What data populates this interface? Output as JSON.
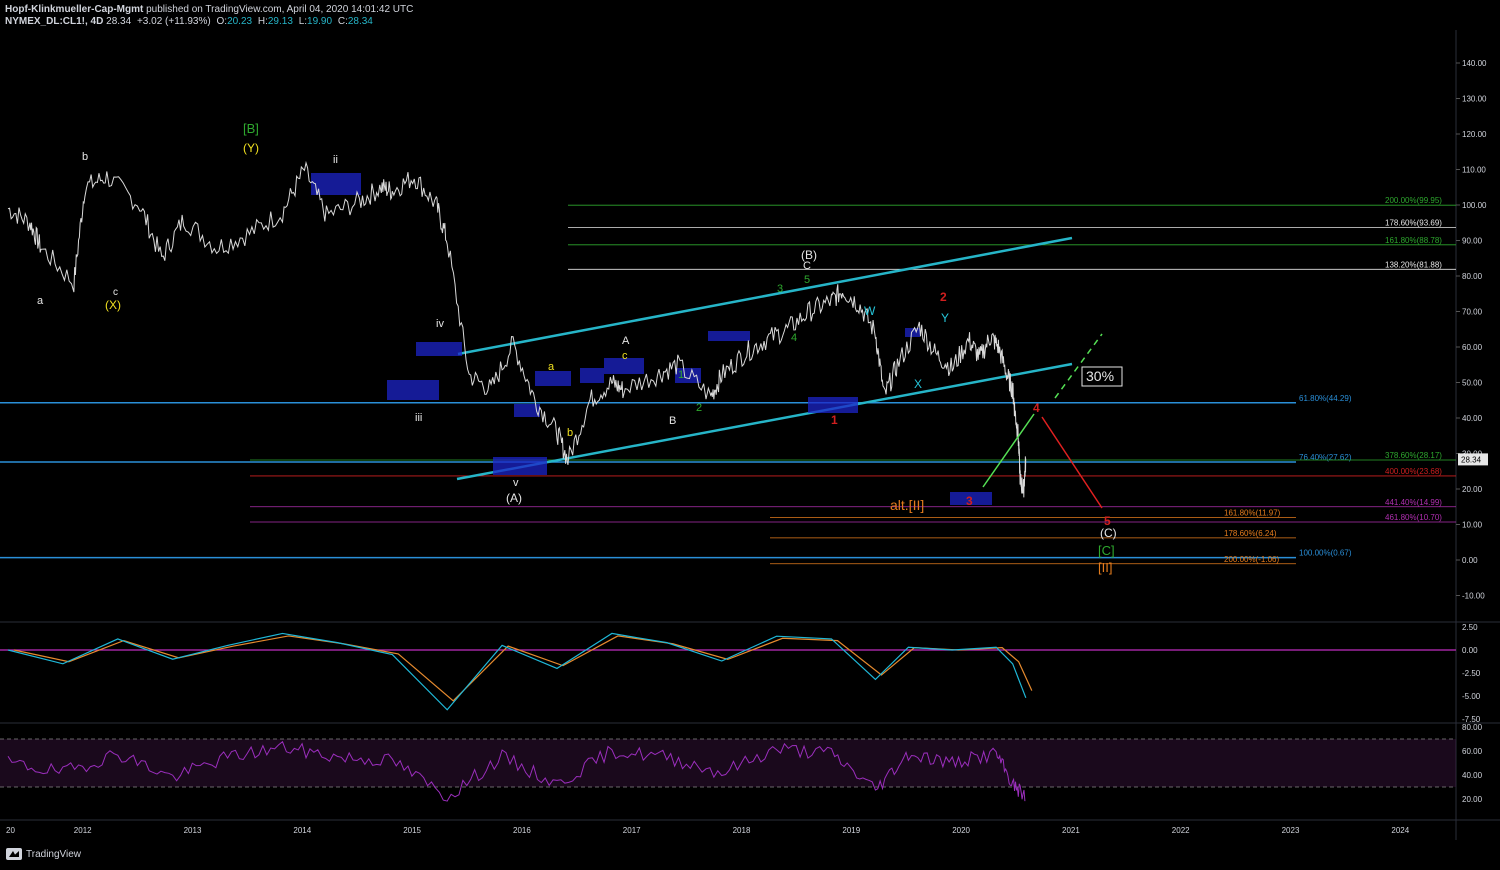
{
  "header": {
    "publisher": "Hopf-Klinkmueller-Cap-Mgmt",
    "published": "published on TradingView.com, April 04, 2020 14:01:42 UTC",
    "symbol": "NYMEX_DL:CL1!, 4D",
    "last": "28.34",
    "change": "+3.02 (+11.93%)",
    "open_label": "O:",
    "open": "20.23",
    "high_label": "H:",
    "high": "29.13",
    "low_label": "L:",
    "low": "19.90",
    "close_label": "C:",
    "close": "28.34"
  },
  "footer": {
    "brand": "TradingView"
  },
  "colors": {
    "bg": "#000000",
    "price": "#d9d9d9",
    "channel": "#26b5c8",
    "fib_blue": "#2a8fd8",
    "green": "#2ea82e",
    "white": "#e6e6e6",
    "orange": "#e37b1d",
    "magenta": "#b12fb1",
    "red": "#d11f1f",
    "box": "#1c24c8",
    "macd": "#1fb8d8",
    "signal": "#e68a2e",
    "rsi": "#9b2ebd"
  },
  "chart_data": [
    {
      "type": "line",
      "title": "",
      "x_ticks": [
        "20",
        "2012",
        "2013",
        "2014",
        "2015",
        "2016",
        "2017",
        "2018",
        "2019",
        "2020",
        "2021",
        "2022",
        "2023",
        "2024"
      ],
      "y_ticks": [
        "140.00",
        "130.00",
        "120.00",
        "110.00",
        "100.00",
        "90.00",
        "80.00",
        "70.00",
        "60.00",
        "50.00",
        "40.00",
        "30.00",
        "20.00",
        "10.00",
        "0.00",
        "-10.00"
      ],
      "ylim": [
        -14,
        147
      ],
      "current_price_label": "28.34",
      "series": [
        {
          "x": [
            2011.0,
            2011.2,
            2011.3,
            2011.6,
            2011.7,
            2011.9,
            2012.2,
            2012.4,
            2012.6,
            2012.9,
            2013.2,
            2013.5,
            2013.7,
            2013.9,
            2014.2,
            2014.4,
            2014.5,
            2014.7,
            2014.9,
            2015.0,
            2015.2,
            2015.4,
            2015.6,
            2015.8,
            2016.0,
            2016.1,
            2016.3,
            2016.5,
            2016.6,
            2016.9,
            2017.1,
            2017.4,
            2017.5,
            2017.7,
            2017.9,
            2018.1,
            2018.3,
            2018.5,
            2018.6,
            2018.75,
            2018.9,
            2018.98,
            2019.1,
            2019.3,
            2019.45,
            2019.6,
            2019.75,
            2019.85,
            2019.95,
            2020.02,
            2020.1,
            2020.15,
            2020.17,
            2020.2,
            2020.22,
            2020.25,
            2020.27
          ],
          "y": [
            99,
            95,
            88,
            78,
            105,
            108,
            100,
            85,
            96,
            88,
            92,
            98,
            110,
            97,
            101,
            105,
            104,
            108,
            100,
            90,
            52,
            48,
            61,
            45,
            36,
            28,
            45,
            50,
            48,
            52,
            55,
            46,
            52,
            58,
            62,
            65,
            70,
            73,
            76,
            72,
            64,
            46,
            55,
            66,
            58,
            54,
            62,
            57,
            63,
            60,
            52,
            48,
            42,
            35,
            22,
            20,
            28.34
          ]
        }
      ],
      "fib_levels": [
        {
          "label": "200.00%(99.95)",
          "value": 99.95,
          "color": "green"
        },
        {
          "label": "178.60%(93.69)",
          "value": 93.69,
          "color": "white"
        },
        {
          "label": "161.80%(88.78)",
          "value": 88.78,
          "color": "green"
        },
        {
          "label": "138.20%(81.88)",
          "value": 81.88,
          "color": "white"
        },
        {
          "label": "61.80%(44.29)",
          "value": 44.29,
          "color": "fib_blue"
        },
        {
          "label": "76.40%(27.62)",
          "value": 27.62,
          "color": "fib_blue"
        },
        {
          "label": "378.60%(28.17)",
          "value": 28.17,
          "color": "green"
        },
        {
          "label": "400.00%(23.68)",
          "value": 23.68,
          "color": "red"
        },
        {
          "label": "441.40%(14.99)",
          "value": 14.99,
          "color": "magenta"
        },
        {
          "label": "461.80%(10.70)",
          "value": 10.7,
          "color": "magenta"
        },
        {
          "label": "161.80%(11.97)",
          "value": 11.97,
          "color": "orange"
        },
        {
          "label": "178.60%(6.24)",
          "value": 6.24,
          "color": "orange"
        },
        {
          "label": "100.00%(0.67)",
          "value": 0.67,
          "color": "fib_blue"
        },
        {
          "label": "200.00%(-1.06)",
          "value": -1.06,
          "color": "orange"
        }
      ],
      "annotations": [
        {
          "text": "[B]",
          "color": "green"
        },
        {
          "text": "(Y)",
          "color": "yellow"
        },
        {
          "text": "b",
          "color": "white"
        },
        {
          "text": "a",
          "color": "white"
        },
        {
          "text": "c",
          "color": "white"
        },
        {
          "text": "(X)",
          "color": "yellow"
        },
        {
          "text": "ii",
          "color": "white"
        },
        {
          "text": "iv",
          "color": "white"
        },
        {
          "text": "iii",
          "color": "white"
        },
        {
          "text": "v",
          "color": "white"
        },
        {
          "text": "(A)",
          "color": "white"
        },
        {
          "text": "a",
          "color": "yellow"
        },
        {
          "text": "b",
          "color": "yellow"
        },
        {
          "text": "A",
          "color": "white"
        },
        {
          "text": "c",
          "color": "yellow"
        },
        {
          "text": "B",
          "color": "white"
        },
        {
          "text": "1",
          "color": "green"
        },
        {
          "text": "2",
          "color": "green"
        },
        {
          "text": "3",
          "color": "green"
        },
        {
          "text": "4",
          "color": "green"
        },
        {
          "text": "5",
          "color": "green"
        },
        {
          "text": "C",
          "color": "white"
        },
        {
          "text": "(B)",
          "color": "white"
        },
        {
          "text": "W",
          "color": "cyan"
        },
        {
          "text": "X",
          "color": "cyan"
        },
        {
          "text": "Y",
          "color": "cyan"
        },
        {
          "text": "1",
          "color": "red"
        },
        {
          "text": "2",
          "color": "red"
        },
        {
          "text": "3",
          "color": "red"
        },
        {
          "text": "4",
          "color": "red"
        },
        {
          "text": "5",
          "color": "red"
        },
        {
          "text": "alt.[II]",
          "color": "orange"
        },
        {
          "text": "(C)",
          "color": "white"
        },
        {
          "text": "[C]",
          "color": "green"
        },
        {
          "text": "[II]",
          "color": "orange"
        },
        {
          "text": "30%",
          "color": "white"
        }
      ]
    },
    {
      "type": "line",
      "y_ticks": [
        "2.50",
        "0.00",
        "-2.50",
        "-5.00",
        "-7.50"
      ],
      "ylim": [
        -7.8,
        2.7
      ],
      "series": [
        {
          "x": [
            2011.0,
            2011.5,
            2012.0,
            2012.5,
            2013.0,
            2013.5,
            2014.0,
            2014.5,
            2015.0,
            2015.5,
            2016.0,
            2016.5,
            2017.0,
            2017.5,
            2018.0,
            2018.5,
            2018.9,
            2019.2,
            2019.6,
            2020.0,
            2020.15,
            2020.27
          ],
          "y": [
            0.0,
            -1.5,
            1.2,
            -1.0,
            0.5,
            1.8,
            0.8,
            -0.5,
            -6.5,
            0.5,
            -2.0,
            1.8,
            0.8,
            -1.2,
            1.5,
            1.2,
            -3.2,
            0.3,
            0.0,
            0.3,
            -1.5,
            -5.2
          ]
        }
      ]
    },
    {
      "type": "line",
      "y_ticks": [
        "80.00",
        "60.00",
        "40.00",
        "20.00"
      ],
      "ylim": [
        13,
        87
      ],
      "overbought": 70,
      "oversold": 30,
      "series": [
        {
          "x": [
            2011.0,
            2011.5,
            2012.0,
            2012.5,
            2013.0,
            2013.5,
            2014.0,
            2014.5,
            2015.0,
            2015.5,
            2016.0,
            2016.5,
            2017.0,
            2017.5,
            2018.0,
            2018.5,
            2018.9,
            2019.2,
            2019.6,
            2020.0,
            2020.15,
            2020.27
          ],
          "y": [
            50,
            42,
            58,
            38,
            55,
            63,
            55,
            52,
            22,
            55,
            32,
            60,
            55,
            42,
            62,
            58,
            28,
            58,
            50,
            58,
            32,
            22
          ]
        }
      ]
    }
  ]
}
